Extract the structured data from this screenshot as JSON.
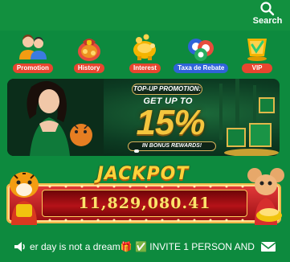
{
  "header": {
    "search_label": "Search"
  },
  "menu": [
    {
      "label": "Promotion",
      "icon": "people-icon",
      "color": "#e8452f"
    },
    {
      "label": "History",
      "icon": "gift-bag-icon",
      "color": "#e8452f"
    },
    {
      "label": "Interest",
      "icon": "piggy-bank-icon",
      "color": "#e8452f"
    },
    {
      "label": "Taxa de Rebate",
      "icon": "chips-icon",
      "color": "#2f63d8"
    },
    {
      "label": "VIP",
      "icon": "vip-crown-icon",
      "color": "#e8452f"
    }
  ],
  "banner": {
    "top_label": "TOP-UP PROMOTION:",
    "get_up_to": "GET UP TO",
    "percent": "15%",
    "bonus_label": "IN BONUS REWARDS!"
  },
  "jackpot": {
    "title": "JACKPOT",
    "value": "11,829,080.41"
  },
  "ticker": {
    "text": "er day is not a dream🎁 ✅ INVITE 1 PERSON AND"
  },
  "colors": {
    "background": "#0d8a3e",
    "jackpot_red": "#c3161c",
    "gold": "#f4c63e"
  }
}
